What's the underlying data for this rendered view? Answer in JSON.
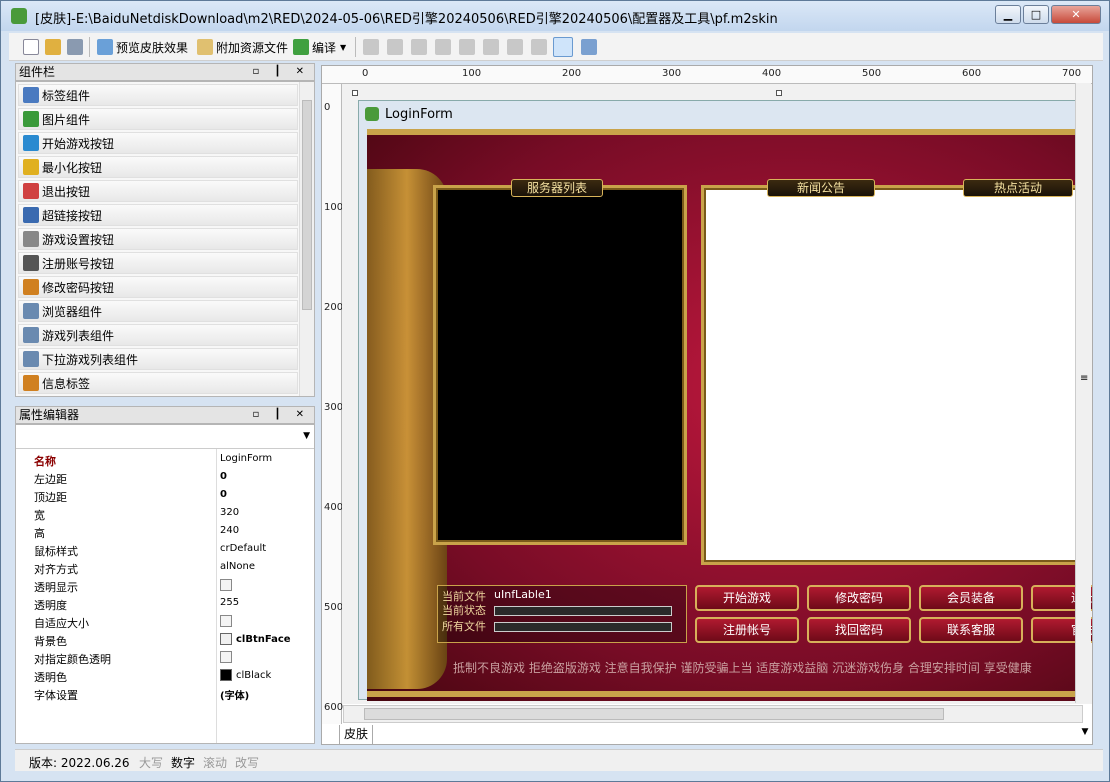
{
  "window": {
    "title": "[皮肤]-E:\\BaiduNetdiskDownload\\m2\\RED\\2024-05-06\\RED引擎20240506\\RED引擎20240506\\配置器及工具\\pf.m2skin",
    "min": "▁",
    "max": "□",
    "close": "✕"
  },
  "toolbar": {
    "preview": "预览皮肤效果",
    "attach": "附加资源文件",
    "compile": "编译"
  },
  "components_panel": {
    "title": "组件栏",
    "items": [
      "标签组件",
      "图片组件",
      "开始游戏按钮",
      "最小化按钮",
      "退出按钮",
      "超链接按钮",
      "游戏设置按钮",
      "注册账号按钮",
      "修改密码按钮",
      "浏览器组件",
      "游戏列表组件",
      "下拉游戏列表组件",
      "信息标签"
    ]
  },
  "property_panel": {
    "title": "属性编辑器",
    "rows": [
      {
        "k": "名称",
        "v": "LoginForm"
      },
      {
        "k": "左边距",
        "v": "0"
      },
      {
        "k": "顶边距",
        "v": "0"
      },
      {
        "k": "宽",
        "v": "320"
      },
      {
        "k": "高",
        "v": "240"
      },
      {
        "k": "鼠标样式",
        "v": "crDefault"
      },
      {
        "k": "对齐方式",
        "v": "alNone"
      },
      {
        "k": "透明显示",
        "v": ""
      },
      {
        "k": "透明度",
        "v": "255"
      },
      {
        "k": "自适应大小",
        "v": ""
      },
      {
        "k": "背景色",
        "v": "clBtnFace"
      },
      {
        "k": "对指定颜色透明",
        "v": ""
      },
      {
        "k": "透明色",
        "v": "clBlack"
      },
      {
        "k": "字体设置",
        "v": "(字体)"
      }
    ]
  },
  "ruler": {
    "top": [
      "0",
      "100",
      "200",
      "300",
      "400",
      "500",
      "600",
      "700"
    ],
    "left": [
      "0",
      "100",
      "200",
      "300",
      "400",
      "500",
      "600"
    ]
  },
  "form": {
    "title": "LoginForm",
    "server_list": "服务器列表",
    "news": "新闻公告",
    "hot": "热点活动",
    "cur_file": "当前文件",
    "cur_file_val": "uInfLable1",
    "cur_status": "当前状态",
    "all_files": "所有文件",
    "buttons": [
      "开始游戏",
      "修改密码",
      "会员装备",
      "退出",
      "注册帐号",
      "找回密码",
      "联系客服",
      "官方"
    ],
    "notice": "抵制不良游戏  拒绝盗版游戏  注意自我保护  谨防受骗上当  适度游戏益脑  沉迷游戏伤身  合理安排时间  享受健康"
  },
  "tab": {
    "label": "皮肤"
  },
  "statusbar": {
    "version": "版本: 2022.06.26",
    "caps": "大写",
    "num": "数字",
    "scroll": "滚动",
    "ins": "改写"
  },
  "colors": {
    "accent": "#c9a34a",
    "bg_red": "#b0153a"
  }
}
